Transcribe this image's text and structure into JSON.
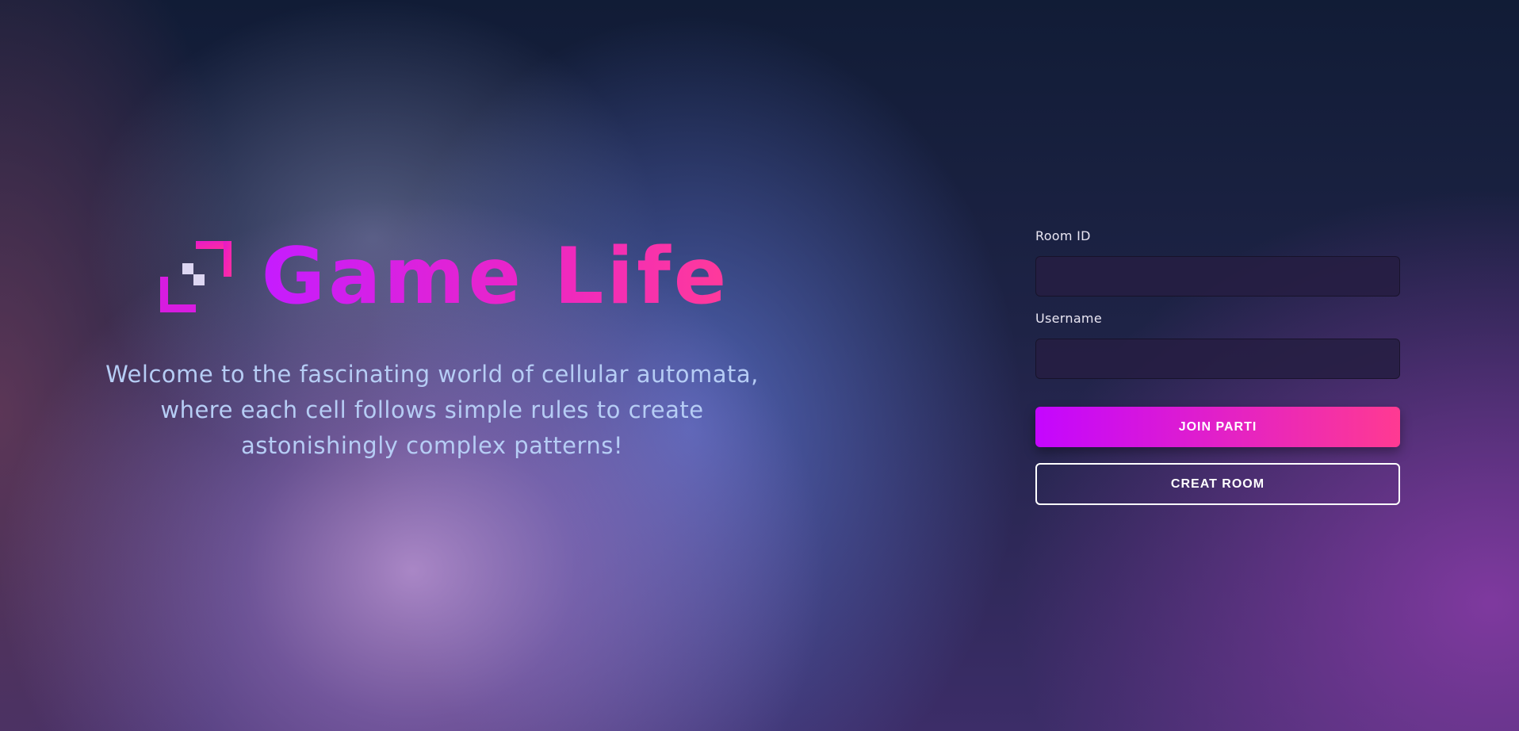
{
  "app": {
    "title": "Game Life",
    "welcome": "Welcome to the fascinating world of cellular automata, where each cell follows simple rules to create astonishingly complex patterns!",
    "logo_icon": "pixel-glider-icon"
  },
  "form": {
    "room_id_label": "Room ID",
    "room_id_value": "",
    "username_label": "Username",
    "username_value": "",
    "join_label": "JOIN PARTI",
    "create_label": "CREAT ROOM"
  },
  "colors": {
    "accent_start": "#c406ff",
    "accent_end": "#ff3a92",
    "welcome_text": "#b6cdf5"
  }
}
